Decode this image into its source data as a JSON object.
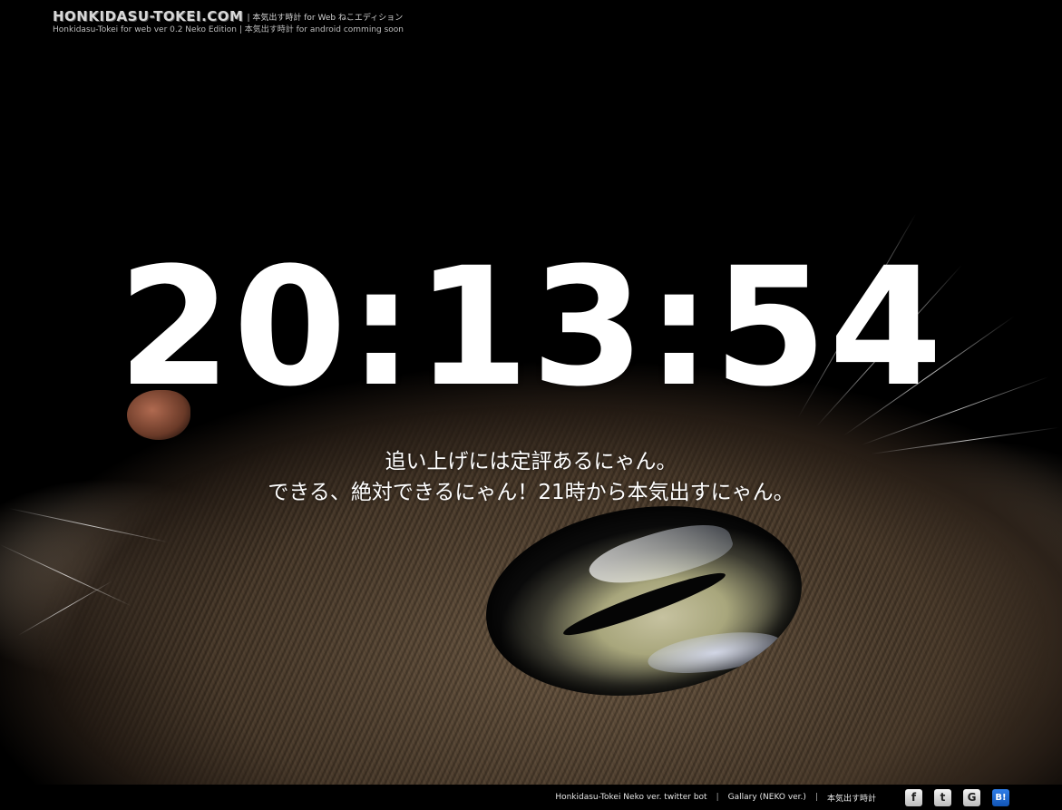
{
  "header": {
    "logo": "HONKIDASU-TOKEI.COM",
    "line1_suffix": "| 本気出す時計 for Web ねこエディション",
    "line2": "Honkidasu-Tokei for web ver 0.2 Neko Edition | 本気出す時計 for android comming soon"
  },
  "clock": {
    "time": "20:13:54"
  },
  "message": {
    "line1": "追い上げには定評あるにゃん。",
    "line2": "できる、絶対できるにゃん！21時から本気出すにゃん。"
  },
  "footer": {
    "links": [
      {
        "label": "Honkidasu-Tokei Neko ver. twitter bot"
      },
      {
        "label": "Gallary (NEKO ver.)"
      },
      {
        "label": "本気出す時計"
      }
    ],
    "separators": [
      "|",
      "|"
    ],
    "social": [
      {
        "icon": "facebook-icon",
        "glyph": "f"
      },
      {
        "icon": "twitter-icon",
        "glyph": "t"
      },
      {
        "icon": "google-icon",
        "glyph": "G"
      },
      {
        "icon": "hatena-bookmark-icon",
        "glyph": "B!"
      }
    ]
  },
  "colors": {
    "background": "#000000",
    "clock_text": "#ffffff",
    "hatena_blue": "#1f6fd6"
  }
}
